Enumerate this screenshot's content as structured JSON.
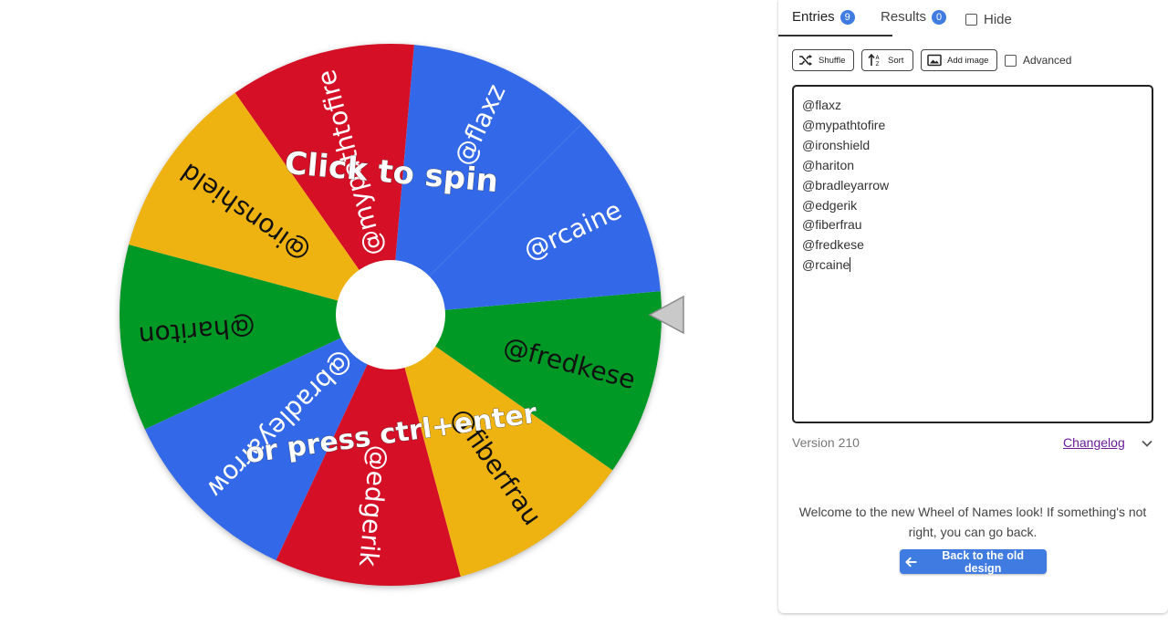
{
  "wheel": {
    "segments": [
      {
        "label": "@flaxz",
        "color": "#3369e8"
      },
      {
        "label": "@mypathtofire",
        "color": "#d50f25"
      },
      {
        "label": "@ironshield",
        "color": "#eeb211"
      },
      {
        "label": "@hariton",
        "color": "#009925"
      },
      {
        "label": "@bradleyarrow",
        "color": "#3369e8"
      },
      {
        "label": "@edgerik",
        "color": "#d50f25"
      },
      {
        "label": "@fiberfrau",
        "color": "#eeb211"
      },
      {
        "label": "@fredkese",
        "color": "#009925"
      },
      {
        "label": "@rcaine",
        "color": "#3369e8"
      }
    ],
    "prompt_line1": "Click to spin",
    "prompt_line2": "or press ctrl+enter"
  },
  "tabs": {
    "entries_label": "Entries",
    "entries_count": "9",
    "results_label": "Results",
    "results_count": "0",
    "hide_label": "Hide"
  },
  "toolbar": {
    "shuffle_label": "Shuffle",
    "sort_label": "Sort",
    "add_image_label": "Add image",
    "advanced_label": "Advanced"
  },
  "entries": [
    "@flaxz",
    "@mypathtofire",
    "@ironshield",
    "@hariton",
    "@bradleyarrow",
    "@edgerik",
    "@fiberfrau",
    "@fredkese",
    "@rcaine"
  ],
  "footer": {
    "version": "Version 210",
    "changelog": "Changelog"
  },
  "welcome": {
    "message": "Welcome to the new Wheel of Names look! If something's not right, you can go back.",
    "back_button": "Back to the old design"
  },
  "colors": {
    "accent": "#3f7be0",
    "blue": "#3369e8",
    "red": "#d50f25",
    "yellow": "#eeb211",
    "green": "#009925"
  }
}
